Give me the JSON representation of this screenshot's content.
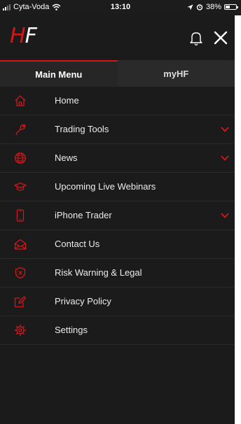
{
  "status_bar": {
    "carrier": "Cyta-Voda",
    "time": "13:10",
    "battery": "38%"
  },
  "header": {
    "logo_h": "H",
    "logo_f": "F"
  },
  "tabs": [
    {
      "label": "Main Menu",
      "active": true
    },
    {
      "label": "myHF",
      "active": false
    }
  ],
  "menu": {
    "items": [
      {
        "label": "Home",
        "icon": "home-icon",
        "expandable": false
      },
      {
        "label": "Trading Tools",
        "icon": "wrench-icon",
        "expandable": true
      },
      {
        "label": "News",
        "icon": "globe-icon",
        "expandable": true
      },
      {
        "label": "Upcoming Live Webinars",
        "icon": "graduation-cap-icon",
        "expandable": false
      },
      {
        "label": "iPhone Trader",
        "icon": "phone-icon",
        "expandable": true
      },
      {
        "label": "Contact Us",
        "icon": "envelope-open-icon",
        "expandable": false
      },
      {
        "label": "Risk Warning & Legal",
        "icon": "shield-warning-icon",
        "expandable": false
      },
      {
        "label": "Privacy Policy",
        "icon": "edit-document-icon",
        "expandable": false
      },
      {
        "label": "Settings",
        "icon": "gear-icon",
        "expandable": false
      }
    ]
  },
  "colors": {
    "accent": "#d4161b",
    "background": "#1b1b1b",
    "text": "#ececec"
  }
}
